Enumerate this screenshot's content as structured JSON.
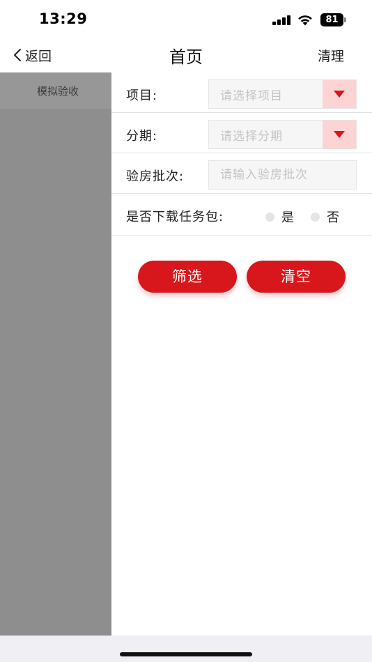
{
  "status_bar": {
    "time": "13:29",
    "battery": "81",
    "icons": [
      "signal-icon",
      "wifi-icon",
      "battery-icon"
    ]
  },
  "nav": {
    "back_label": "返回",
    "title": "首页",
    "right_action": "清理",
    "icons": [
      "chevron-left-icon"
    ]
  },
  "sidebar": {
    "items": [
      {
        "label": "模拟验收",
        "selected": true
      }
    ]
  },
  "form": {
    "project": {
      "label": "项目:",
      "placeholder": "请选择项目"
    },
    "phase": {
      "label": "分期:",
      "placeholder": "请选择分期"
    },
    "batch": {
      "label": "验房批次:",
      "placeholder": "请输入验房批次",
      "value": ""
    },
    "download": {
      "label": "是否下载任务包:",
      "options": [
        {
          "label": "是",
          "checked": false
        },
        {
          "label": "否",
          "checked": false
        }
      ]
    }
  },
  "actions": {
    "filter_label": "筛选",
    "clear_label": "清空"
  },
  "colors": {
    "accent": "#d8171c",
    "arrow_bg": "#fdd3d3",
    "sidebar_bg": "#8e8e8e",
    "sidebar_item_bg": "#979797"
  }
}
